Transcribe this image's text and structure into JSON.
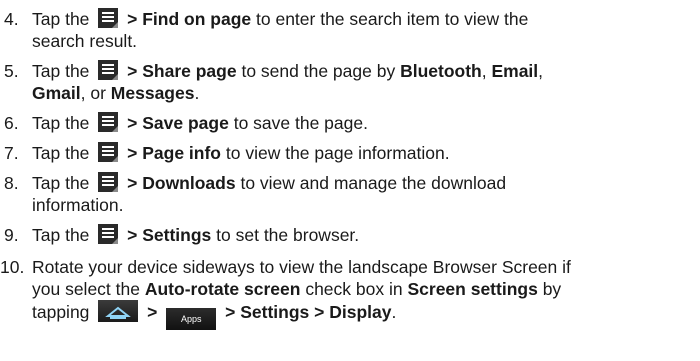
{
  "items": [
    {
      "number": "4.",
      "line1": {
        "pre": "Tap the",
        "bold": "> Find on page",
        "post": "to enter the search item to view the"
      },
      "line2": "search result."
    },
    {
      "number": "5.",
      "line1": {
        "pre": "Tap the",
        "bold": "> Share page",
        "post": "to send the page by",
        "b1": "Bluetooth",
        "sep1": ", ",
        "b2": "Email",
        "sep2": ","
      },
      "line2": {
        "b3": "Gmail",
        "sep3": ", or ",
        "b4": "Messages",
        "end": "."
      }
    },
    {
      "number": "6.",
      "line1": {
        "pre": "Tap the",
        "bold": "> Save page",
        "post": "to save the page."
      }
    },
    {
      "number": "7.",
      "line1": {
        "pre": "Tap the",
        "bold": "> Page info",
        "post": "to view the page information."
      }
    },
    {
      "number": "8.",
      "line1": {
        "pre": "Tap the",
        "bold": "> Downloads",
        "post": "to view and manage the download"
      },
      "line2": "information."
    },
    {
      "number": "9.",
      "line1": {
        "pre": "Tap the",
        "bold": "> Settings",
        "post": "to set the browser."
      }
    },
    {
      "number": "10.",
      "line1": "Rotate your device sideways to view the landscape Browser Screen if",
      "line2": {
        "pre": "you select the",
        "b1": "Auto-rotate screen",
        "mid": "check box in",
        "b2": "Screen settings",
        "post": "by"
      },
      "line3": {
        "pre": "tapping",
        "gt1": ">",
        "apps_label": "Apps",
        "b": "> Settings > Display",
        "end": "."
      }
    }
  ],
  "icons": {
    "menu": "menu-icon",
    "home": "home-icon",
    "apps": "apps-icon"
  },
  "colors": {
    "text": "#1a1a1a",
    "icon_bg": "#2a2a2a"
  }
}
